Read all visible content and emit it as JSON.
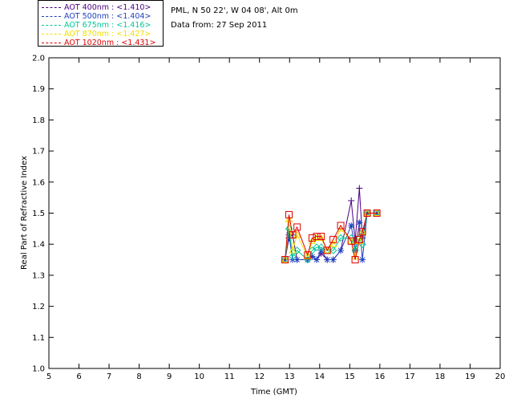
{
  "header": {
    "site": "PML, N 50 22', W 04 08', Alt 0m",
    "date_line": "Data from: 27 Sep 2011"
  },
  "legend": [
    {
      "label": "AOT  400nm : <1.410>",
      "color": "#4b0082"
    },
    {
      "label": "AOT  500nm : <1.404>",
      "color": "#1f3fbf"
    },
    {
      "label": "AOT  675nm : <1.416>",
      "color": "#00c896"
    },
    {
      "label": "AOT  870nm : <1.427>",
      "color": "#f0e000"
    },
    {
      "label": "AOT 1020nm : <1.431>",
      "color": "#e00000"
    }
  ],
  "chart_data": {
    "type": "line",
    "xlabel": "Time (GMT)",
    "ylabel": "Real Part of Refractive Index",
    "xlim": [
      5,
      20
    ],
    "ylim": [
      1.0,
      2.0
    ],
    "xticks": [
      "5",
      "6",
      "7",
      "8",
      "9",
      "10",
      "11",
      "12",
      "13",
      "14",
      "15",
      "16",
      "17",
      "18",
      "19",
      "20"
    ],
    "yticks": [
      "1.0",
      "1.1",
      "1.2",
      "1.3",
      "1.4",
      "1.5",
      "1.6",
      "1.7",
      "1.8",
      "1.9",
      "2.0"
    ],
    "x": [
      12.85,
      12.98,
      13.1,
      13.25,
      13.6,
      13.75,
      13.9,
      14.05,
      14.25,
      14.45,
      14.7,
      15.05,
      15.18,
      15.32,
      15.42,
      15.58,
      15.9
    ],
    "series": [
      {
        "name": "AOT  400nm",
        "marker": "plus",
        "values": [
          1.35,
          1.42,
          1.43,
          1.35,
          1.35,
          1.36,
          1.35,
          1.37,
          1.35,
          1.35,
          1.38,
          1.54,
          1.41,
          1.58,
          1.42,
          1.5,
          1.5
        ]
      },
      {
        "name": "AOT  500nm",
        "marker": "asterisk",
        "values": [
          1.35,
          1.43,
          1.35,
          1.35,
          1.35,
          1.36,
          1.35,
          1.38,
          1.35,
          1.35,
          1.38,
          1.46,
          1.38,
          1.47,
          1.35,
          1.5,
          1.5
        ]
      },
      {
        "name": "AOT  675nm",
        "marker": "diamond",
        "values": [
          1.35,
          1.45,
          1.36,
          1.38,
          1.35,
          1.38,
          1.39,
          1.39,
          1.38,
          1.38,
          1.42,
          1.42,
          1.38,
          1.42,
          1.4,
          1.5,
          1.5
        ]
      },
      {
        "name": "AOT  870nm",
        "marker": "triangle",
        "values": [
          1.35,
          1.48,
          1.38,
          1.43,
          1.36,
          1.41,
          1.42,
          1.42,
          1.38,
          1.4,
          1.45,
          1.41,
          1.36,
          1.41,
          1.44,
          1.5,
          1.5
        ]
      },
      {
        "name": "AOT 1020nm",
        "marker": "square",
        "values": [
          1.35,
          1.495,
          1.43,
          1.455,
          1.365,
          1.42,
          1.425,
          1.425,
          1.38,
          1.415,
          1.46,
          1.41,
          1.35,
          1.415,
          1.44,
          1.5,
          1.5
        ]
      }
    ]
  }
}
